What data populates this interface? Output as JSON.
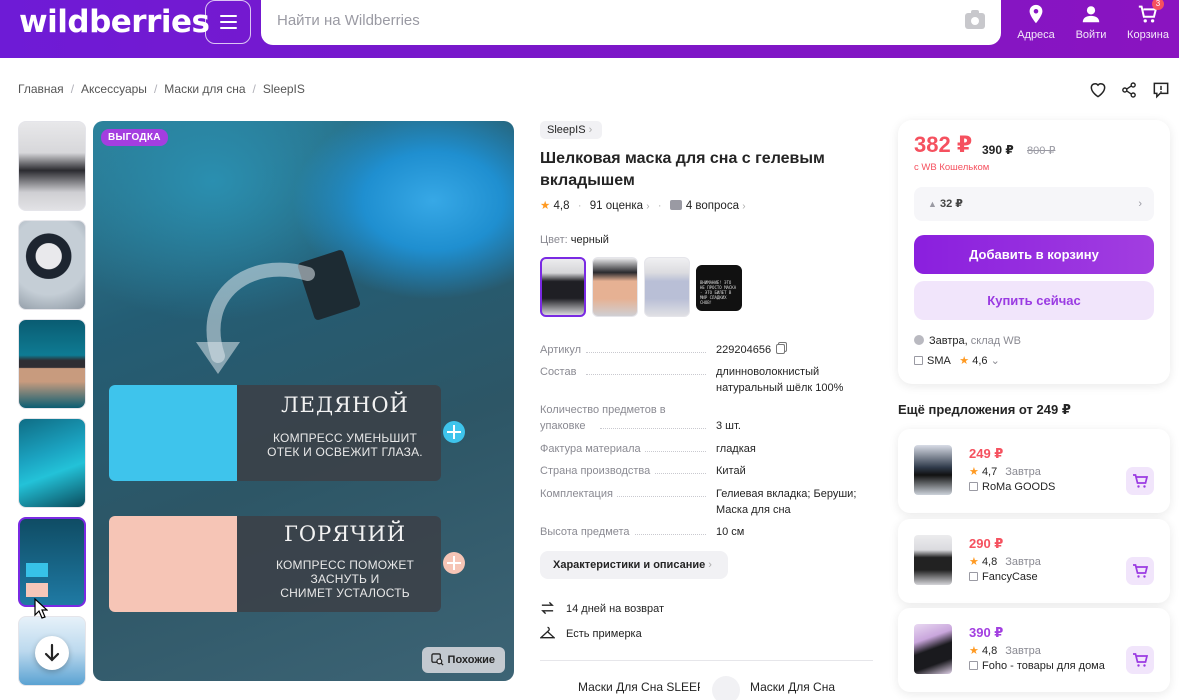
{
  "header": {
    "logo": "wildberries",
    "search_placeholder": "Найти на Wildberries",
    "nav": [
      {
        "label": "Адреса"
      },
      {
        "label": "Войти"
      },
      {
        "label": "Корзина",
        "badge": "3"
      }
    ]
  },
  "breadcrumb": [
    "Главная",
    "Аксессуары",
    "Маски для сна",
    "SleepIS"
  ],
  "gallery": {
    "badge": "ВЫГОДКА",
    "panel_cold_title": "ЛЕДЯНОЙ",
    "panel_cold_text_1": "КОМПРЕСС УМЕНЬШИТ",
    "panel_cold_text_2": "ОТЕК И ОСВЕЖИТ ГЛАЗА.",
    "panel_hot_title": "ГОРЯЧИЙ",
    "panel_hot_text_1": "КОМПРЕСС ПОМОЖЕТ",
    "panel_hot_text_2": "ЗАСНУТЬ И",
    "panel_hot_text_3": "СНИМЕТ УСТАЛОСТЬ",
    "similar_label": "Похожие",
    "color_accent_cold": "#3ec4ec",
    "color_accent_hot": "#f6c5b6"
  },
  "product": {
    "brand": "SleepIS",
    "title": "Шелковая маска для сна с гелевым вкладышем",
    "rating": "4,8",
    "reviews": "91 оценка",
    "questions": "4 вопроса",
    "color_label": "Цвет:",
    "color_value": "черный",
    "variant_4_text": "ВНИМАНИЕ! ЭТО НЕ ПРОСТО МАСКА - ЭТО БИЛЕТ В МИР СЛАДКИХ СНОВ!",
    "specs": [
      {
        "k": "Артикул",
        "v": "229204656"
      },
      {
        "k": "Состав",
        "v": "длинноволокнистый натуральный шёлк 100%"
      },
      {
        "k": "Количество предметов в упаковке",
        "v": "3 шт."
      },
      {
        "k": "Фактура материала",
        "v": "гладкая"
      },
      {
        "k": "Страна производства",
        "v": "Китай"
      },
      {
        "k": "Комплектация",
        "v": "Гелиевая вкладка; Беруши; Маска для сна"
      },
      {
        "k": "Высота предмета",
        "v": "10 см"
      }
    ],
    "chars_button": "Характеристики и описание",
    "features": [
      "14 дней на возврат",
      "Есть примерка"
    ],
    "tags": [
      "Маски Для Сна SLEEPI",
      "Маски Для Сна"
    ]
  },
  "price": {
    "current": "382 ₽",
    "base": "390 ₽",
    "old": "800 ₽",
    "wallet_note": "с WB Кошельком",
    "cashback": "32 ₽",
    "add_to_cart": "Добавить в корзину",
    "buy_now": "Купить сейчас",
    "delivery_day": "Завтра,",
    "delivery_wh": "склад WB",
    "seller": "SMA",
    "seller_rating": "4,6"
  },
  "offers": {
    "title": "Ещё предложения от 249 ₽",
    "items": [
      {
        "price": "249 ₽",
        "rating": "4,7",
        "delivery": "Завтра",
        "seller": "RoMa GOODS",
        "price_color": "#f5515f"
      },
      {
        "price": "290 ₽",
        "rating": "4,8",
        "delivery": "Завтра",
        "seller": "FancyCase",
        "price_color": "#f5515f"
      },
      {
        "price": "390 ₽",
        "rating": "4,8",
        "delivery": "Завтра",
        "seller": "Foho - товары для дома",
        "price_color": "#a23ee0"
      }
    ]
  },
  "colors": {
    "brand": "#7a17c9",
    "sale": "#f5515f",
    "accent": "#a23ee0"
  }
}
